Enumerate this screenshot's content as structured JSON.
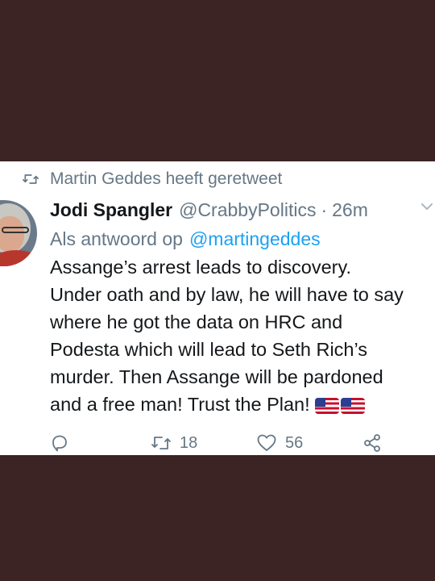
{
  "retweet_context": {
    "icon": "retweet-icon",
    "text": "Martin Geddes heeft geretweet"
  },
  "tweet": {
    "display_name": "Jodi Spangler",
    "handle": "@CrabbyPolitics",
    "separator": "·",
    "timestamp": "26m",
    "reply_prefix": "Als antwoord op",
    "reply_mention": "@martingeddes",
    "text_lines": [
      "Assange’s arrest leads to discovery.",
      "Under oath and by law, he will have to say",
      "where he got the data on HRC and",
      "Podesta which will lead to Seth Rich’s",
      "murder. Then Assange will be pardoned",
      "and a free man! Trust the Plan!"
    ],
    "emoji": [
      "us-flag",
      "us-flag"
    ]
  },
  "actions": {
    "reply": {
      "icon": "reply-icon",
      "count": ""
    },
    "retweet": {
      "icon": "retweet-icon",
      "count": "18"
    },
    "like": {
      "icon": "heart-icon",
      "count": "56"
    },
    "share": {
      "icon": "share-icon"
    }
  },
  "colors": {
    "background": "#3b2423",
    "card": "#ffffff",
    "primary_text": "#14171a",
    "secondary_text": "#657786",
    "link": "#1da1f2"
  }
}
